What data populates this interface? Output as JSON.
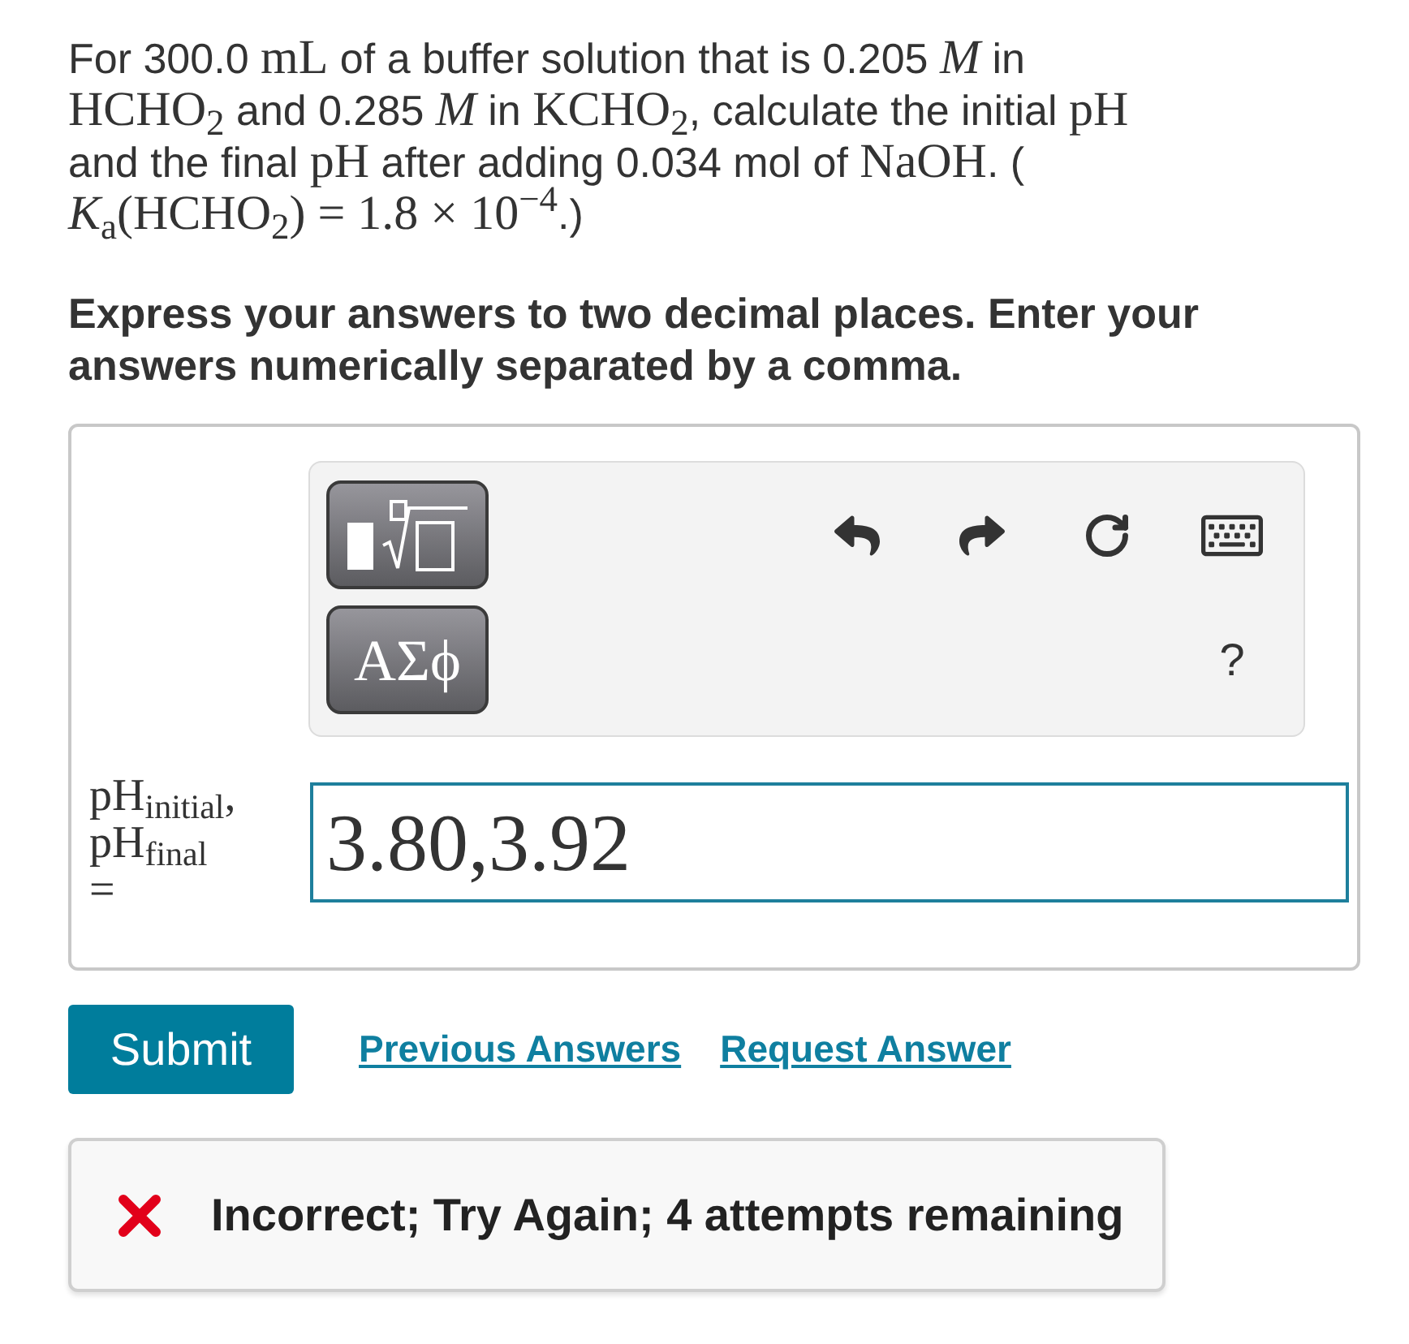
{
  "question": {
    "segments": [
      {
        "kind": "text",
        "text": "For 300.0 "
      },
      {
        "kind": "math",
        "text": "mL"
      },
      {
        "kind": "text",
        "text": " of a buffer solution that is 0.205 "
      },
      {
        "kind": "math",
        "text": "*M*"
      },
      {
        "kind": "text",
        "text": " in "
      },
      {
        "kind": "math",
        "text": "HCHO$_{2}$"
      },
      {
        "kind": "text",
        "text": " and 0.285 "
      },
      {
        "kind": "math",
        "text": "*M*"
      },
      {
        "kind": "text",
        "text": " in "
      },
      {
        "kind": "math",
        "text": "KCHO$_{2}$"
      },
      {
        "kind": "text",
        "text": ", calculate the initial "
      },
      {
        "kind": "math",
        "text": "pH"
      },
      {
        "kind": "text",
        "text": " and the final "
      },
      {
        "kind": "math",
        "text": "pH"
      },
      {
        "kind": "text",
        "text": " after adding 0.034 mol of "
      },
      {
        "kind": "math",
        "text": "NaOH"
      },
      {
        "kind": "text",
        "text": ". ( "
      },
      {
        "kind": "math",
        "text": "*K*$_{a}$(HCHO$_{2}$) = 1.8 × 10$^{−4}$"
      },
      {
        "kind": "text",
        "text": ".)"
      }
    ]
  },
  "instructions": "Express your answers to two decimal places. Enter your answers numerically separated by a comma.",
  "toolbar": {
    "symbols_button": "ΑΣϕ",
    "help_button": "?"
  },
  "answer": {
    "label": "pH$_{initial}$, pH$_{final}$ =",
    "value": "3.80,3.92"
  },
  "actions": {
    "submit": "Submit",
    "links": [
      "Previous Answers",
      "Request Answer"
    ]
  },
  "feedback": {
    "kind": "incorrect",
    "text": "Incorrect; Try Again; 4 attempts remaining"
  }
}
